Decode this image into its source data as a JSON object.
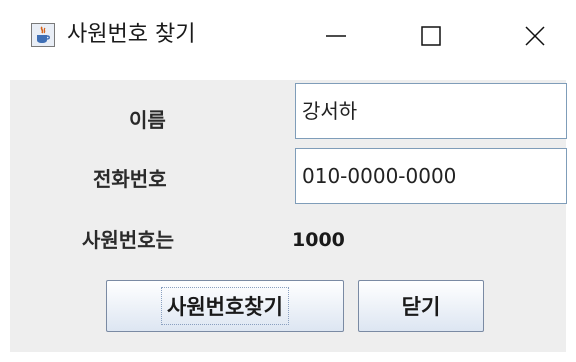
{
  "window": {
    "title": "사원번호 찾기",
    "controls": {
      "minimize_icon": "minimize-icon",
      "maximize_icon": "maximize-icon",
      "close_icon": "close-icon"
    },
    "app_icon": "java-coffee-icon"
  },
  "form": {
    "name_label": "이름",
    "name_value": "강서하",
    "phone_label": "전화번호",
    "phone_value": "010-0000-0000",
    "result_label": "사원번호는",
    "result_value": "1000"
  },
  "buttons": {
    "find_label": "사원번호찾기",
    "close_label": "닫기"
  },
  "colors": {
    "panel_bg": "#eeeeee",
    "field_border": "#7f9db9",
    "button_border": "#7a8aa3"
  }
}
